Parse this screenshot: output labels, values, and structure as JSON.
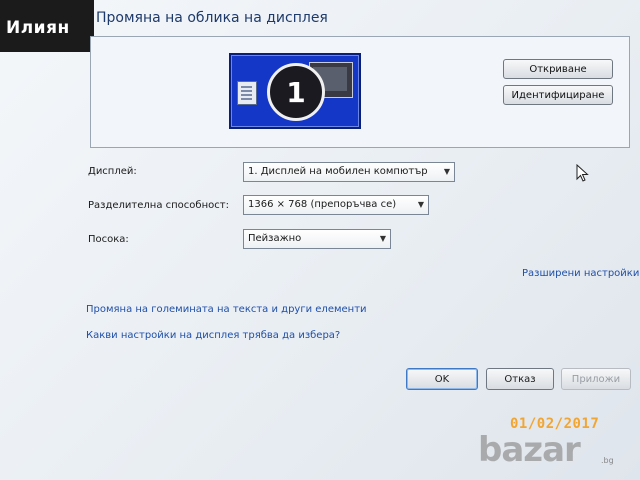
{
  "overlay": {
    "name": "Илиян",
    "date": "01/02/2017",
    "watermark": "bazar",
    "watermark_suffix": ".bg"
  },
  "dialog": {
    "title": "Промяна на облика на дисплея",
    "preview": {
      "monitor_number": "1",
      "detect_label": "Откриване",
      "identify_label": "Идентифициране"
    },
    "fields": {
      "display_label": "Дисплей:",
      "display_value": "1. Дисплей на мобилен компютър",
      "resolution_label": "Разделителна способност:",
      "resolution_value": "1366 × 768 (препоръчва се)",
      "orientation_label": "Посока:",
      "orientation_value": "Пейзажно"
    },
    "links": {
      "advanced": "Разширени настройки",
      "text_size": "Промяна на големината на текста и други елементи",
      "which_settings": "Какви настройки на дисплея трябва да избера?"
    },
    "buttons": {
      "ok": "OK",
      "cancel": "Отказ",
      "apply": "Приложи"
    }
  },
  "icons": {
    "dropdown": "chevron-down-icon",
    "cursor": "mouse-pointer-icon"
  },
  "colors": {
    "monitor": "#1537c8",
    "link": "#1f4fa8",
    "date": "#f2a531"
  }
}
